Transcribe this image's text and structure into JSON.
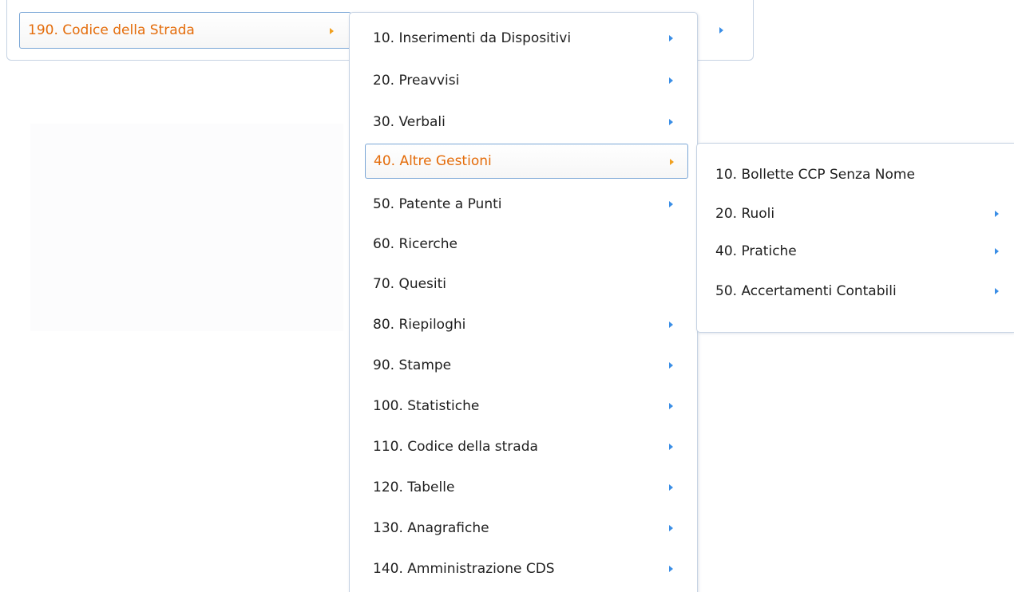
{
  "menu": {
    "level1": {
      "active_item": "190. Codice della Strada"
    },
    "level2": {
      "items": [
        {
          "label": "10. Inserimenti da Dispositivi",
          "has_submenu": true
        },
        {
          "label": "20. Preavvisi",
          "has_submenu": true
        },
        {
          "label": "30. Verbali",
          "has_submenu": true
        },
        {
          "label": "40. Altre Gestioni",
          "has_submenu": true,
          "active": true
        },
        {
          "label": "50. Patente a Punti",
          "has_submenu": true
        },
        {
          "label": "60. Ricerche",
          "has_submenu": false
        },
        {
          "label": "70. Quesiti",
          "has_submenu": false
        },
        {
          "label": "80. Riepiloghi",
          "has_submenu": true
        },
        {
          "label": "90. Stampe",
          "has_submenu": true
        },
        {
          "label": "100. Statistiche",
          "has_submenu": true
        },
        {
          "label": "110. Codice della strada",
          "has_submenu": true
        },
        {
          "label": "120. Tabelle",
          "has_submenu": true
        },
        {
          "label": "130. Anagrafiche",
          "has_submenu": true
        },
        {
          "label": "140. Amministrazione CDS",
          "has_submenu": true
        }
      ]
    },
    "level3": {
      "items": [
        {
          "label": "10. Bollette CCP Senza Nome",
          "has_submenu": false
        },
        {
          "label": "20. Ruoli",
          "has_submenu": true
        },
        {
          "label": "40. Pratiche",
          "has_submenu": true
        },
        {
          "label": "50. Accertamenti Contabili",
          "has_submenu": true
        }
      ]
    }
  },
  "colors": {
    "active_text": "#e46c0a",
    "arrow": "#3a8ee6",
    "active_arrow": "#f0a020",
    "border": "#c6d3e3",
    "active_border": "#7aa6d6"
  },
  "icons": {
    "submenu": "chevron-right-icon"
  }
}
